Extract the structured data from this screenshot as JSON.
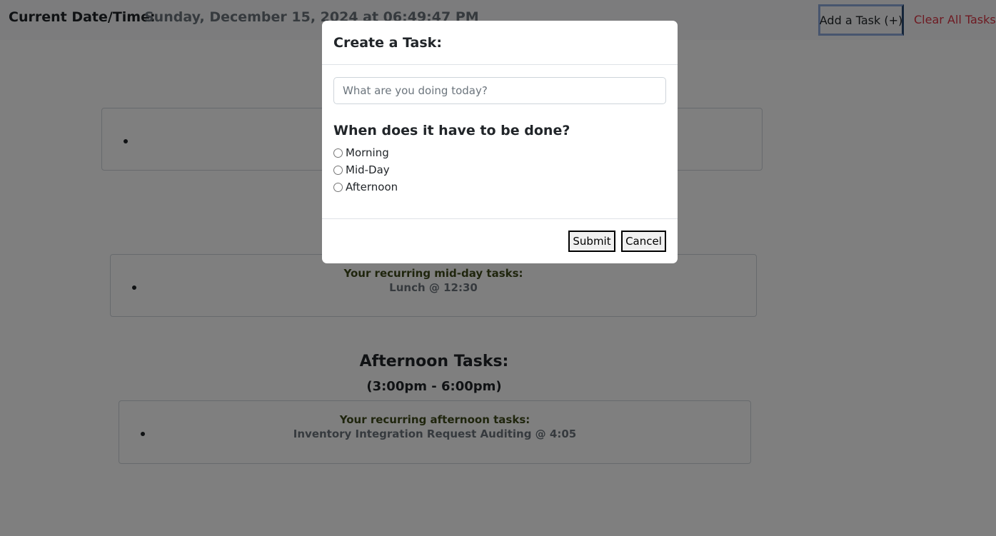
{
  "header": {
    "datetime_label": "Current Date/Time:",
    "datetime_value": "Sunday, December 15, 2024 at 06:49:47 PM",
    "add_task_label": "Add a Task (+)",
    "clear_all_label": "Clear All Tasks"
  },
  "sections": {
    "midday": {
      "recurring_title": "Your recurring mid-day tasks:",
      "recurring_item": "Lunch @ 12:30"
    },
    "afternoon": {
      "title": "Afternoon Tasks:",
      "time_range": "(3:00pm - 6:00pm)",
      "recurring_title": "Your recurring afternoon tasks:",
      "recurring_item": "Inventory Integration Request Auditing @ 4:05"
    }
  },
  "modal": {
    "title": "Create a Task:",
    "input_placeholder": "What are you doing today?",
    "input_value": "",
    "when_heading": "When does it have to be done?",
    "options": [
      "Morning",
      "Mid-Day",
      "Afternoon"
    ],
    "submit_label": "Submit",
    "cancel_label": "Cancel"
  },
  "colors": {
    "clear_link": "#dc3545",
    "overlay": "rgba(0,0,0,0.5)",
    "add_button_border": "#8faadc"
  }
}
